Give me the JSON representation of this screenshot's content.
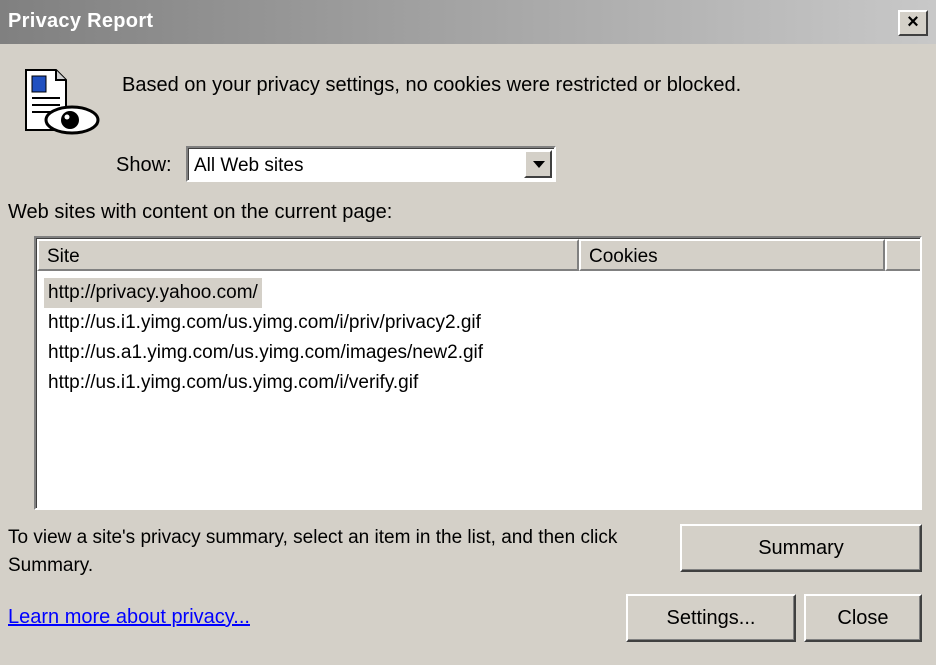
{
  "window": {
    "title": "Privacy Report",
    "close_glyph": "×"
  },
  "message": "Based on your privacy settings, no cookies were restricted or blocked.",
  "show": {
    "label": "Show:",
    "selected": "All Web sites"
  },
  "content_label": "Web sites with content on the current page:",
  "list": {
    "columns": [
      "Site",
      "Cookies"
    ],
    "rows": [
      {
        "site": "http://privacy.yahoo.com/",
        "cookies": ""
      },
      {
        "site": "http://us.i1.yimg.com/us.yimg.com/i/priv/privacy2.gif",
        "cookies": ""
      },
      {
        "site": "http://us.a1.yimg.com/us.yimg.com/images/new2.gif",
        "cookies": ""
      },
      {
        "site": "http://us.i1.yimg.com/us.yimg.com/i/verify.gif",
        "cookies": ""
      }
    ]
  },
  "hint": "To view a site's privacy summary, select an item in the list, and then click Summary.",
  "buttons": {
    "summary": "Summary",
    "settings": "Settings...",
    "close": "Close"
  },
  "learn_more_link": "Learn more about privacy...",
  "icons": {
    "report": "privacy-report-icon",
    "dropdown": "chevron-down-icon",
    "close": "close-icon"
  },
  "colors": {
    "dialog_bg": "#d4d0c8",
    "link": "#0000ff"
  }
}
